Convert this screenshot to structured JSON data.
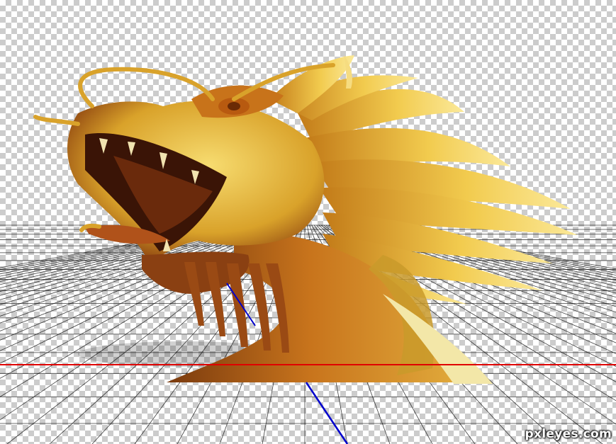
{
  "canvas": {
    "transparency_checker": true,
    "checker_colors": [
      "#ffffff",
      "#cccccc"
    ],
    "perspective_grid": {
      "visible": true,
      "horizon_line_color": "#e00000",
      "axis_line_color": "#0000cc",
      "grid_line_color": "#000000"
    }
  },
  "layer": {
    "subject": "golden-dragon-head",
    "colors": {
      "gold_light": "#f5d35a",
      "gold_mid": "#d99a1e",
      "bronze": "#a8551a",
      "dark_mouth": "#3a1406"
    }
  },
  "watermark": {
    "text": "pxleyes.com"
  }
}
